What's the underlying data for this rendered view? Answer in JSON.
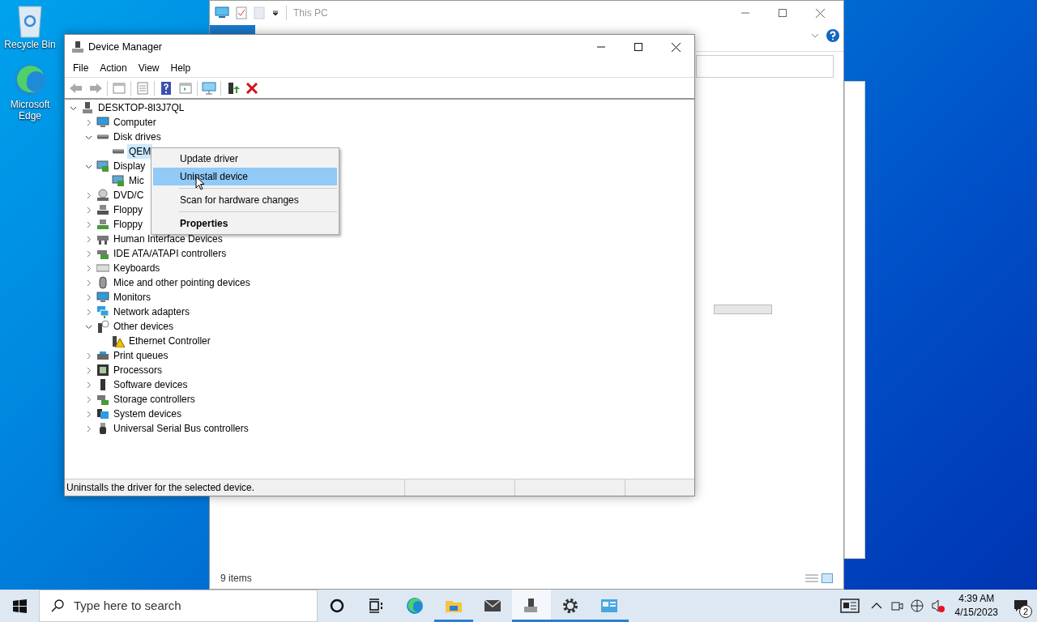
{
  "desktop_icons": [
    {
      "label": "Recycle Bin",
      "kind": "recycle"
    },
    {
      "label": "Microsoft Edge",
      "kind": "edge"
    }
  ],
  "explorer": {
    "title": "This PC",
    "status": "9 items"
  },
  "device_manager": {
    "title": "Device Manager",
    "menu": [
      "File",
      "Action",
      "View",
      "Help"
    ],
    "tree": {
      "label": "DESKTOP-8I3J7QL",
      "kind": "pc",
      "expanded": true,
      "selected": false,
      "children": [
        {
          "label": "Computer",
          "kind": "monitor",
          "expanded": false,
          "selected": false
        },
        {
          "label": "Disk drives",
          "kind": "disk",
          "expanded": true,
          "selected": false,
          "children": [
            {
              "label": "QEM",
              "kind": "disk",
              "selected": true
            }
          ]
        },
        {
          "label": "Display",
          "kind": "display",
          "expanded": true,
          "selected": false,
          "children": [
            {
              "label": "Mic",
              "kind": "display",
              "selected": false
            }
          ]
        },
        {
          "label": "DVD/C",
          "kind": "dvd",
          "expanded": false,
          "selected": false
        },
        {
          "label": "Floppy",
          "kind": "floppy",
          "expanded": false,
          "selected": false
        },
        {
          "label": "Floppy",
          "kind": "floppy2",
          "expanded": false,
          "selected": false
        },
        {
          "label": "Human Interface Devices",
          "kind": "hid",
          "expanded": false,
          "selected": false
        },
        {
          "label": "IDE ATA/ATAPI controllers",
          "kind": "ide",
          "expanded": false,
          "selected": false
        },
        {
          "label": "Keyboards",
          "kind": "keyboard",
          "expanded": false,
          "selected": false
        },
        {
          "label": "Mice and other pointing devices",
          "kind": "mouse",
          "expanded": false,
          "selected": false
        },
        {
          "label": "Monitors",
          "kind": "monitor",
          "expanded": false,
          "selected": false
        },
        {
          "label": "Network adapters",
          "kind": "network",
          "expanded": false,
          "selected": false
        },
        {
          "label": "Other devices",
          "kind": "other",
          "expanded": true,
          "selected": false,
          "children": [
            {
              "label": "Ethernet Controller",
              "kind": "warning",
              "selected": false
            }
          ]
        },
        {
          "label": "Print queues",
          "kind": "printer",
          "expanded": false,
          "selected": false
        },
        {
          "label": "Processors",
          "kind": "cpu",
          "expanded": false,
          "selected": false
        },
        {
          "label": "Software devices",
          "kind": "software",
          "expanded": false,
          "selected": false
        },
        {
          "label": "Storage controllers",
          "kind": "storage",
          "expanded": false,
          "selected": false
        },
        {
          "label": "System devices",
          "kind": "system",
          "expanded": false,
          "selected": false
        },
        {
          "label": "Universal Serial Bus controllers",
          "kind": "usb",
          "expanded": false,
          "selected": false
        }
      ]
    },
    "status_bar": "Uninstalls the driver for the selected device."
  },
  "context_menu": {
    "items": [
      {
        "label": "Update driver",
        "selected": false,
        "default": false,
        "separator_before": false
      },
      {
        "label": "Uninstall device",
        "selected": true,
        "default": false,
        "separator_before": false
      },
      {
        "label": "Scan for hardware changes",
        "selected": false,
        "default": false,
        "separator_before": true
      },
      {
        "label": "Properties",
        "selected": false,
        "default": true,
        "separator_before": true
      }
    ]
  },
  "taskbar": {
    "search_placeholder": "Type here to search",
    "apps": [
      {
        "kind": "cortana",
        "running": false,
        "active": false
      },
      {
        "kind": "taskview",
        "running": false,
        "active": false
      },
      {
        "kind": "edge",
        "running": false,
        "active": false
      },
      {
        "kind": "explorer",
        "running": true,
        "active": false
      },
      {
        "kind": "mail",
        "running": false,
        "active": false
      },
      {
        "kind": "devmgr",
        "running": true,
        "active": true
      },
      {
        "kind": "settings",
        "running": true,
        "active": false
      },
      {
        "kind": "control",
        "running": true,
        "active": false
      }
    ],
    "time": "4:39 AM",
    "date": "4/15/2023",
    "notifications": "2"
  }
}
